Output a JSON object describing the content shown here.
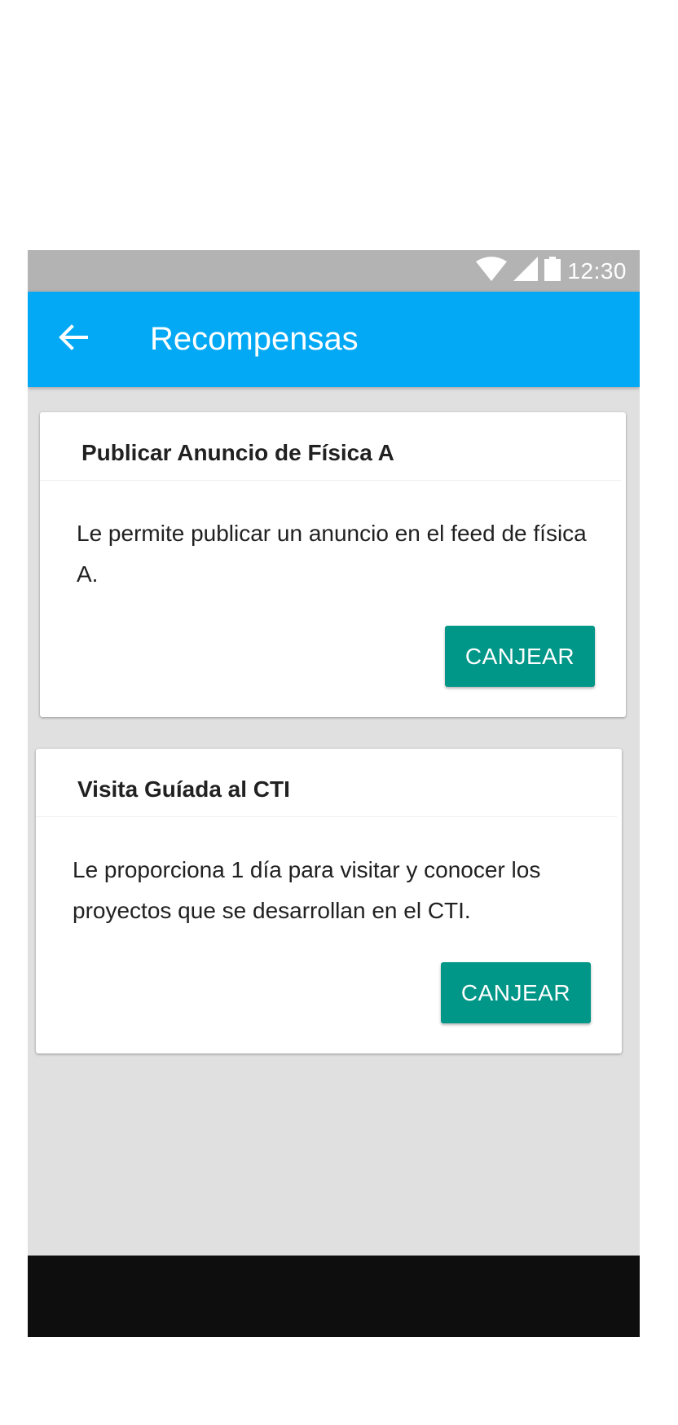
{
  "status_bar": {
    "time": "12:30",
    "icons": [
      "wifi-icon",
      "signal-icon",
      "battery-icon"
    ]
  },
  "app_bar": {
    "back_icon": "arrow-back-icon",
    "title": "Recompensas",
    "color": "#03a9f4"
  },
  "rewards": [
    {
      "title": "Publicar Anuncio de Física A",
      "description": "Le permite publicar un anuncio en el feed de física A.",
      "action_label": "CANJEAR"
    },
    {
      "title": "Visita Guíada al CTI",
      "description": "Le proporciona 1 día para visitar y conocer los proyectos que se desarrollan en el CTI.",
      "action_label": "CANJEAR"
    }
  ],
  "colors": {
    "accent": "#009688",
    "status_bar": "#b3b3b3",
    "background": "#e0e0e0",
    "nav_bar": "#0e0e0e"
  }
}
